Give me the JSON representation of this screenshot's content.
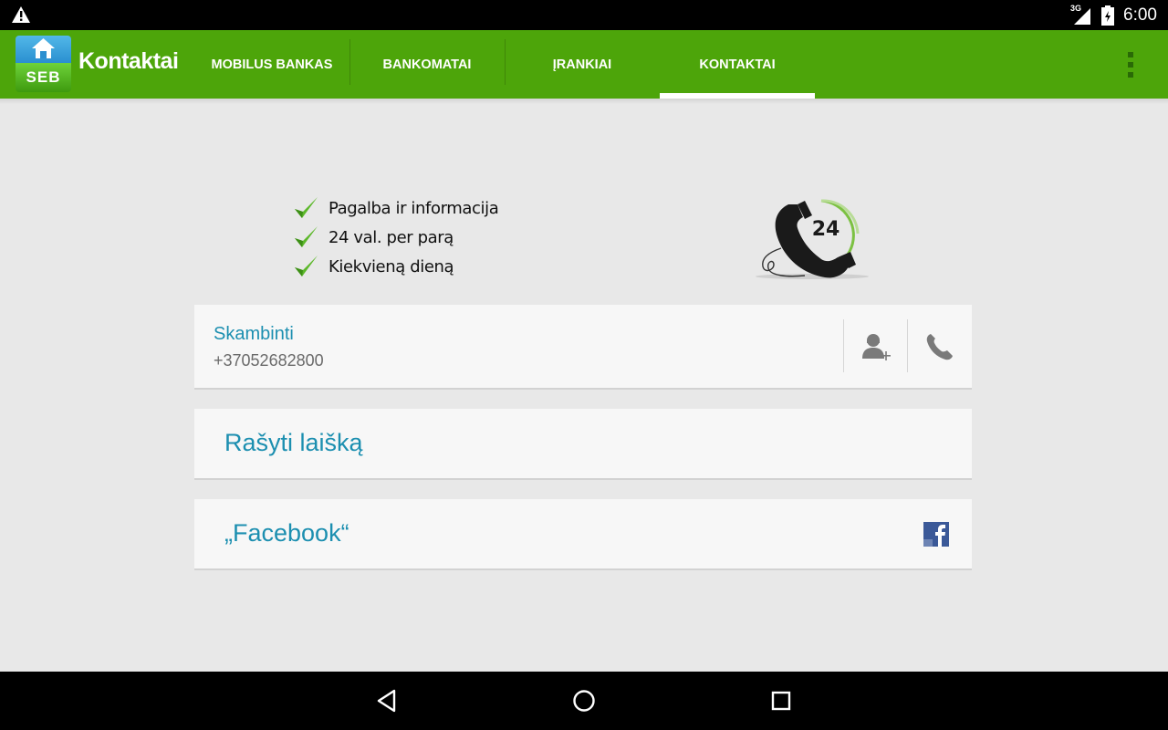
{
  "status_bar": {
    "network": "3G",
    "time": "6:00",
    "icons": [
      "warning-icon",
      "signal-icon",
      "battery-icon"
    ]
  },
  "action_bar": {
    "logo_text": "SEB",
    "title": "Kontaktai",
    "tabs": [
      {
        "label": "MOBILUS BANKAS",
        "active": false
      },
      {
        "label": "BANKOMATAI",
        "active": false
      },
      {
        "label": "ĮRANKIAI",
        "active": false
      },
      {
        "label": "KONTAKTAI",
        "active": true
      }
    ],
    "overflow_icon": "overflow-menu-icon"
  },
  "banner": {
    "features": [
      "Pagalba ir informacija",
      "24 val. per parą",
      "Kiekvieną dieną"
    ],
    "badge_number": "24"
  },
  "call_card": {
    "title": "Skambinti",
    "number": "+37052682800",
    "add_contact_icon": "add-contact-icon",
    "phone_icon": "phone-icon"
  },
  "mail_card": {
    "label": "Rašyti laišką"
  },
  "facebook_card": {
    "label": "„Facebook“",
    "icon": "facebook-icon"
  },
  "colors": {
    "action_bar": "#4da50a",
    "link_text": "#1c8fb0",
    "background": "#e8e8e8",
    "card": "#f7f7f7"
  },
  "nav_bar": {
    "buttons": [
      "back-icon",
      "home-icon",
      "recents-icon"
    ]
  }
}
